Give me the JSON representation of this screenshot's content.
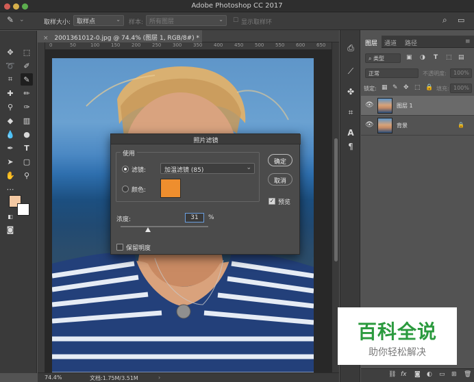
{
  "app": {
    "title": "Adobe Photoshop CC 2017"
  },
  "options_bar": {
    "sample_size_label": "取样大小:",
    "sample_size_value": "取样点",
    "sample_label": "样本:",
    "sample_value": "所有图层",
    "show_ring_label": "显示取样环"
  },
  "document": {
    "tab_label": "2001361012-0.jpg @ 74.4% (图层 1, RGB/8#) *",
    "ruler_ticks": [
      "0",
      "50",
      "100",
      "150",
      "200",
      "250",
      "300",
      "350",
      "400",
      "450",
      "500",
      "550",
      "600",
      "650"
    ]
  },
  "status": {
    "zoom": "74.4%",
    "doc_info": "文档:1.75M/3.51M"
  },
  "layers_panel": {
    "tabs": [
      "图层",
      "通道",
      "路径"
    ],
    "filter_label": "类型",
    "blend_mode": "正常",
    "opacity_label": "不透明度:",
    "opacity_value": "100%",
    "lock_label": "锁定:",
    "fill_label": "填充:",
    "fill_value": "100%",
    "layers": [
      {
        "name": "图层 1",
        "selected": true
      },
      {
        "name": "背景",
        "selected": false,
        "locked": true
      }
    ]
  },
  "photo_filter_dialog": {
    "title": "照片滤镜",
    "use_label": "使用",
    "filter_label": "滤镜:",
    "filter_value": "加温滤镜 (85)",
    "color_label": "颜色:",
    "color_swatch": "#ee8e2e",
    "filter_selected": true,
    "density_label": "浓度:",
    "density_value": "31",
    "density_unit": "%",
    "density_fraction": 0.31,
    "preserve_luminosity_label": "保留明度",
    "preserve_luminosity_checked": false,
    "ok_label": "确定",
    "cancel_label": "取消",
    "preview_label": "预览",
    "preview_checked": true
  },
  "colors": {
    "foreground": "#f4c9a3",
    "background": "#ffffff"
  },
  "watermark": {
    "title": "百科全说",
    "subtitle": "助你轻松解决",
    "color": "#2b9a3e"
  }
}
